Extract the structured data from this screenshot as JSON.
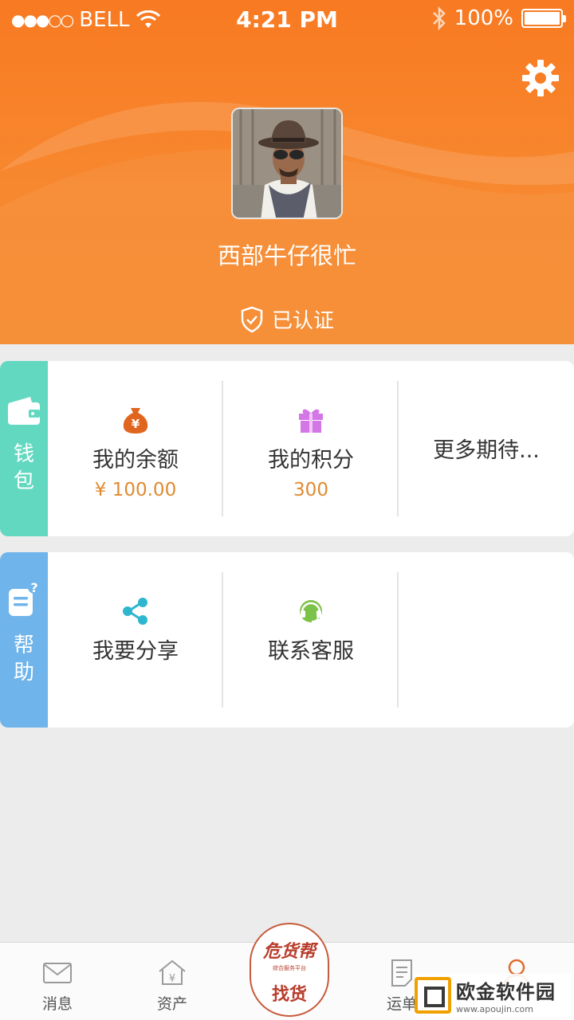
{
  "status_bar": {
    "signal": "●●●○○",
    "carrier": "BELL",
    "time": "4:21 PM",
    "battery": "100%"
  },
  "profile": {
    "username": "西部牛仔很忙",
    "verified_label": "已认证"
  },
  "wallet": {
    "side_label": "钱包",
    "items": [
      {
        "title": "我的余额",
        "value": "¥ 100.00",
        "icon": "money-bag-icon"
      },
      {
        "title": "我的积分",
        "value": "300",
        "icon": "gift-icon"
      },
      {
        "title": "更多期待..."
      }
    ]
  },
  "help": {
    "side_label": "帮助",
    "items": [
      {
        "title": "我要分享",
        "icon": "share-icon"
      },
      {
        "title": "联系客服",
        "icon": "headset-icon"
      }
    ]
  },
  "tabbar": {
    "tabs": [
      {
        "label": "消息",
        "icon": "mail-icon"
      },
      {
        "label": "资产",
        "icon": "house-yen-icon"
      },
      {
        "label": "找货",
        "logo_text": "危货帮",
        "logo_sub": "综合服务平台"
      },
      {
        "label": "运单",
        "icon": "document-icon"
      },
      {
        "label": "",
        "icon": "user-icon",
        "active": true
      }
    ]
  },
  "watermark": {
    "title": "欧金软件园",
    "url": "www.apoujin.com"
  },
  "colors": {
    "header": "#f7822a",
    "wallet_side": "#62d8c1",
    "help_side": "#6fb4ea",
    "accent": "#e08a30"
  }
}
